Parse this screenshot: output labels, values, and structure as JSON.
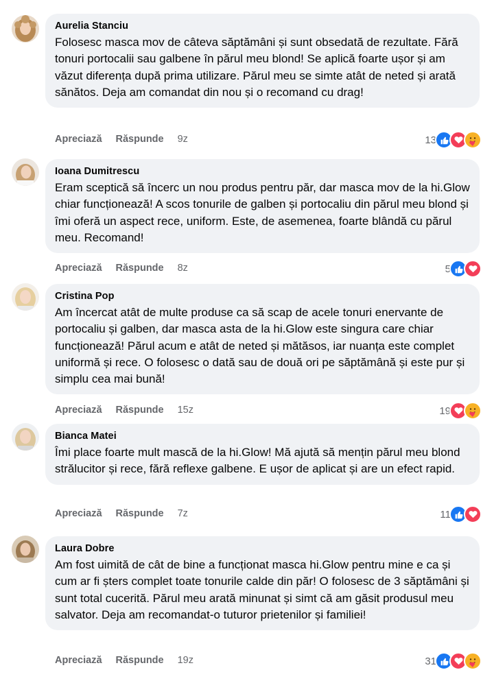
{
  "labels": {
    "like": "Apreciază",
    "reply": "Răspunde"
  },
  "colors": {
    "like": "#1877f2",
    "love": "#f33e58",
    "care": "#f7b125",
    "bubble": "#f0f2f5"
  },
  "comments": [
    {
      "author": "Aurelia Stanciu",
      "text": "Folosesc masca mov de câteva săptămâni și sunt obsedată de rezultate. Fără tonuri portocalii sau galbene în părul meu blond! Se aplică foarte ușor și am văzut diferența după prima utilizare. Părul meu se simte atât de neted și arată sănătos. Deja am comandat din nou și o recomand cu drag!",
      "time": "9z",
      "reaction_count": "13",
      "reactions": [
        "like-icon",
        "love-icon",
        "care-icon"
      ]
    },
    {
      "author": "Ioana Dumitrescu",
      "text": "Eram sceptică să încerc un nou produs pentru păr, dar masca mov de la hi.Glow chiar funcționează! A scos tonurile de galben și portocaliu din părul meu blond și îmi oferă un aspect rece, uniform. Este, de asemenea, foarte blândă cu părul meu. Recomand!",
      "time": "8z",
      "reaction_count": "5",
      "reactions": [
        "like-icon",
        "love-icon"
      ]
    },
    {
      "author": "Cristina Pop",
      "text": "Am încercat atât de multe produse ca să scap de acele tonuri enervante de portocaliu și galben, dar masca asta de la hi.Glow este singura care chiar funcționează! Părul acum e atât de neted și mătăsos, iar nuanța este complet uniformă și rece. O folosesc o dată sau de două ori pe săptămână și este pur și simplu cea mai bună!",
      "time": "15z",
      "reaction_count": "19",
      "reactions": [
        "love-icon",
        "care-icon"
      ]
    },
    {
      "author": "Bianca Matei",
      "text": "Îmi place foarte mult mască de la hi.Glow! Mă ajută să mențin părul meu blond strălucitor și rece, fără reflexe galbene. E ușor de aplicat și are un efect rapid.",
      "time": "7z",
      "reaction_count": "11",
      "reactions": [
        "like-icon",
        "love-icon"
      ]
    },
    {
      "author": "Laura Dobre",
      "text": "Am fost uimită de cât de bine a funcționat masca hi.Glow pentru mine e ca și cum ar fi șters complet toate tonurile calde din păr! O folosesc de 3 săptămâni și sunt total cucerită. Părul meu arată minunat și simt că am găsit produsul meu salvator. Deja am recomandat-o tuturor prietenilor și familiei!",
      "time": "19z",
      "reaction_count": "31",
      "reactions": [
        "like-icon",
        "love-icon",
        "care-icon"
      ]
    }
  ]
}
